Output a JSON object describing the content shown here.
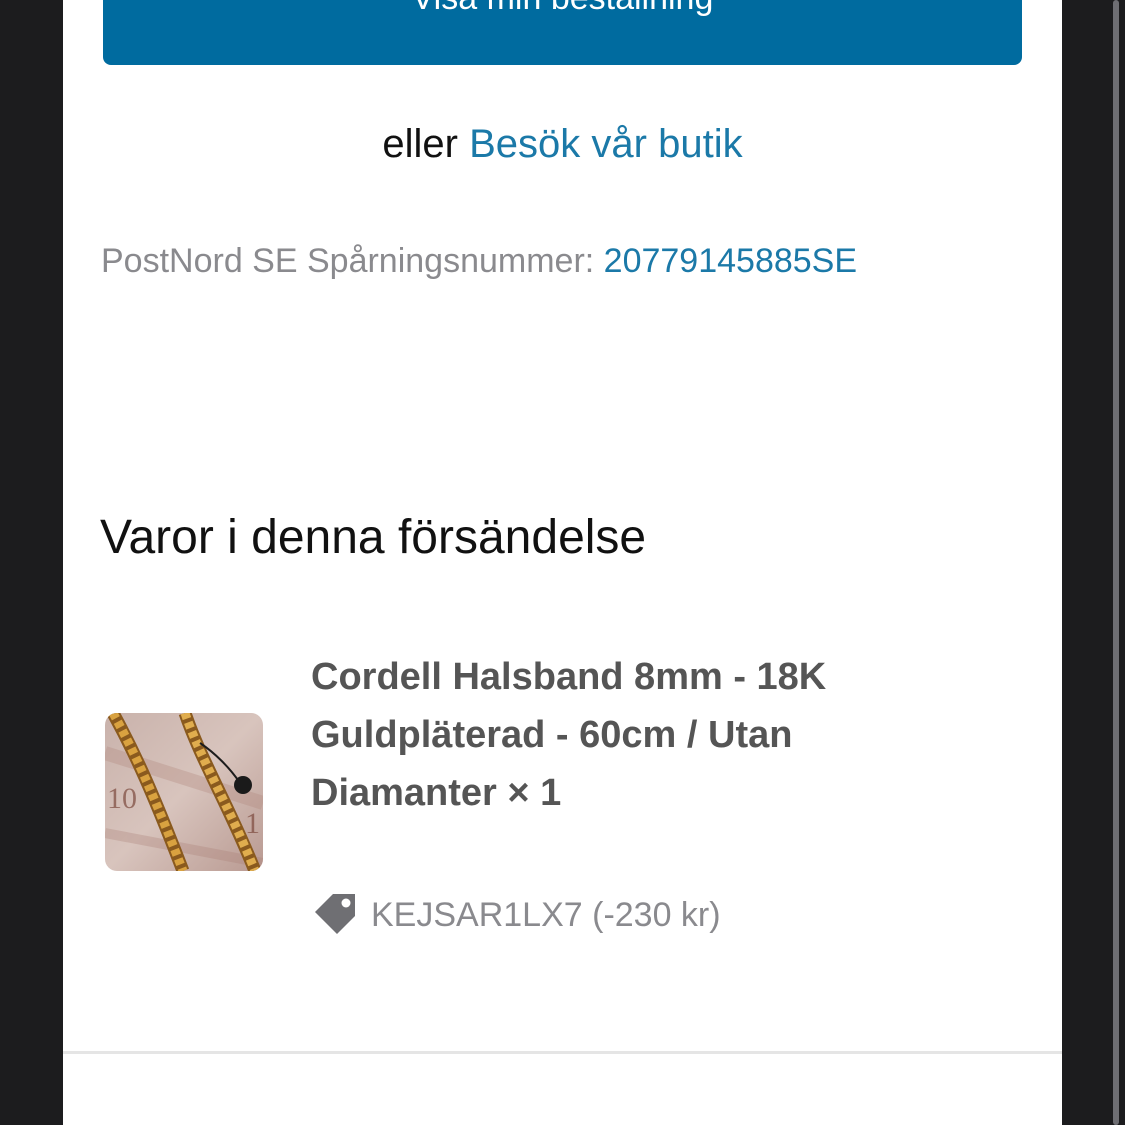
{
  "actions": {
    "primary_button_label": "Visa min beställning",
    "or_text": "eller",
    "visit_store_label": "Besök vår butik"
  },
  "tracking": {
    "label": "PostNord SE Spårningsnummer:",
    "number": "20779145885SE"
  },
  "shipment": {
    "heading": "Varor i denna försändelse",
    "items": [
      {
        "title": "Cordell Halsband 8mm - 18K Guldpläterad - 60cm / Utan Diamanter × 1",
        "thumbnail_icon": "gold-chain-image",
        "discount_icon": "price-tag-icon",
        "discount": "KEJSAR1LX7 (-230 kr)"
      }
    ]
  },
  "colors": {
    "accent": "#006b9f",
    "link": "#1b79a8",
    "muted_text": "#8a8a8e"
  }
}
